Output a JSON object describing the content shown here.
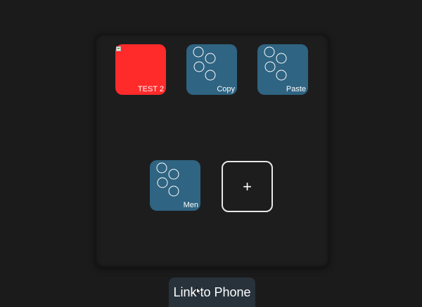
{
  "tiles": [
    {
      "label": "TEST 2",
      "color": "#ff2a2a",
      "icon": "broken-image-icon"
    },
    {
      "label": "Copy",
      "color": "#2f6482",
      "icon": "circles-icon"
    },
    {
      "label": "Paste",
      "color": "#2f6482",
      "icon": "circles-icon"
    },
    {
      "label": "Men",
      "color": "#2f6482",
      "icon": "circles-icon"
    }
  ],
  "add_tile": {
    "symbol": "+"
  },
  "link_button": {
    "label": "Link to Phone"
  },
  "colors": {
    "background": "#1b1b1c",
    "panel": "#1d1d1e",
    "tile_blue": "#2f6482",
    "tile_red": "#ff2a2a",
    "link_button": "#28323b"
  }
}
